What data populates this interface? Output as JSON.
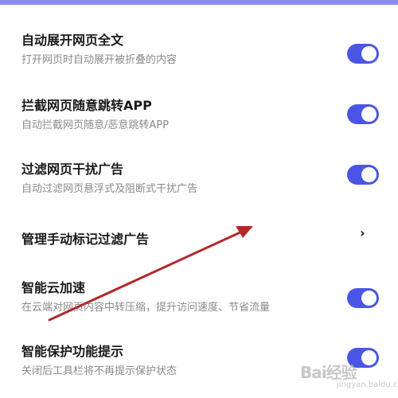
{
  "settings": [
    {
      "title": "自动展开网页全文",
      "subtitle": "打开网页时自动展开被折叠的内容",
      "control": "toggle",
      "on": true
    },
    {
      "title": "拦截网页随意跳转APP",
      "subtitle": "自动拦截网页随意/恶意跳转APP",
      "control": "toggle",
      "on": true
    },
    {
      "title": "过滤网页干扰广告",
      "subtitle": "自动过滤网页悬浮式及阻断式干扰广告",
      "control": "toggle",
      "on": true
    },
    {
      "title": "管理手动标记过滤广告",
      "control": "chevron",
      "chevron": "›"
    },
    {
      "title": "智能云加速",
      "subtitle": "在云端对网页内容中转压缩，提升访问速度、节省流量",
      "control": "toggle",
      "on": true
    },
    {
      "title": "智能保护功能提示",
      "subtitle": "关闭后工具栏将不再提示保护状态",
      "control": "toggle",
      "on": true
    }
  ],
  "colors": {
    "accent": "#4b55e5",
    "annotation_arrow": "#b02a2a"
  },
  "watermark": {
    "brand": "Bai经验",
    "domain": "jingyan.baidu.com"
  }
}
